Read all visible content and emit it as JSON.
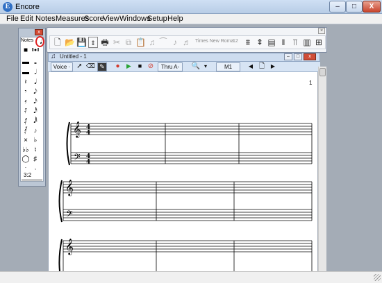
{
  "window": {
    "title": "Encore",
    "app_icon_letter": "E"
  },
  "window_buttons": {
    "minimize": "–",
    "maximize": "□",
    "close": "X"
  },
  "menu": [
    "File",
    "Edit",
    "Notes",
    "Measures",
    "Score",
    "View",
    "Windows",
    "Setup",
    "Help"
  ],
  "toolbar": {
    "icons": [
      "new-document-icon",
      "open-folder-icon",
      "save-icon",
      "properties-icon",
      "print-icon",
      "cut-icon",
      "copy-icon",
      "paste-icon",
      "beam-icon",
      "slur-icon",
      "tuplet-icon",
      "chord-icon",
      "staff-icon",
      "voice-up-icon",
      "voice-down-icon",
      "flip-icon",
      "bar-icon",
      "stem-icon",
      "align-icon",
      "add-measure-icon"
    ],
    "font_name": "Times New Roma",
    "font_size": "12"
  },
  "notes_palette": {
    "tab_label": "Notes",
    "tuplet_label": "3:2"
  },
  "score_window": {
    "icon": "♫",
    "title": "Untitled - 1",
    "voice_label": "Voice ·",
    "range_label": "Thru A-",
    "measure_label": "M1",
    "page_number": "1"
  },
  "colors": {
    "record": "#d33a2c",
    "play": "#2aa336",
    "highlight": "#e02020"
  }
}
